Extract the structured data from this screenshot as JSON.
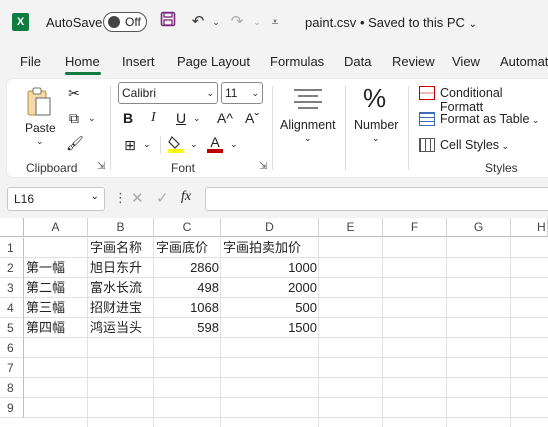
{
  "titlebar": {
    "autosave_label": "AutoSave",
    "autosave_state": "Off",
    "filename": "paint.csv",
    "save_status": "Saved to this PC"
  },
  "tabs": [
    "File",
    "Home",
    "Insert",
    "Page Layout",
    "Formulas",
    "Data",
    "Review",
    "View",
    "Automat"
  ],
  "active_tab": "Home",
  "ribbon": {
    "clipboard": {
      "paste": "Paste",
      "label": "Clipboard"
    },
    "font": {
      "name": "Calibri",
      "size": "11",
      "bold": "B",
      "italic": "I",
      "underline": "U",
      "grow": "A^",
      "shrink": "Aˇ",
      "label": "Font",
      "highlight_color": "#ffff00",
      "font_color": "#c00000"
    },
    "alignment": {
      "label": "Alignment"
    },
    "number": {
      "label": "Number",
      "symbol": "%"
    },
    "styles": {
      "conditional": "Conditional Formatt",
      "format_table": "Format as Table",
      "cell_styles": "Cell Styles",
      "label": "Styles"
    }
  },
  "formula_bar": {
    "name_box": "L16",
    "fx": "fx",
    "value": ""
  },
  "grid": {
    "columns": [
      "A",
      "B",
      "C",
      "D",
      "E",
      "F",
      "G",
      "H"
    ],
    "rows": [
      "1",
      "2",
      "3",
      "4",
      "5",
      "6",
      "7",
      "8",
      "9"
    ],
    "cells": [
      [
        "",
        "字画名称",
        "字画底价",
        "字画拍卖加价"
      ],
      [
        "第一幅",
        "旭日东升",
        "2860",
        "1000"
      ],
      [
        "第二幅",
        "富水长流",
        "498",
        "2000"
      ],
      [
        "第三幅",
        "招财进宝",
        "1068",
        "500"
      ],
      [
        "第四幅",
        "鸿运当头",
        "598",
        "1500"
      ]
    ]
  },
  "colors": {
    "excel_green": "#107c41",
    "accent": "#107c41"
  }
}
